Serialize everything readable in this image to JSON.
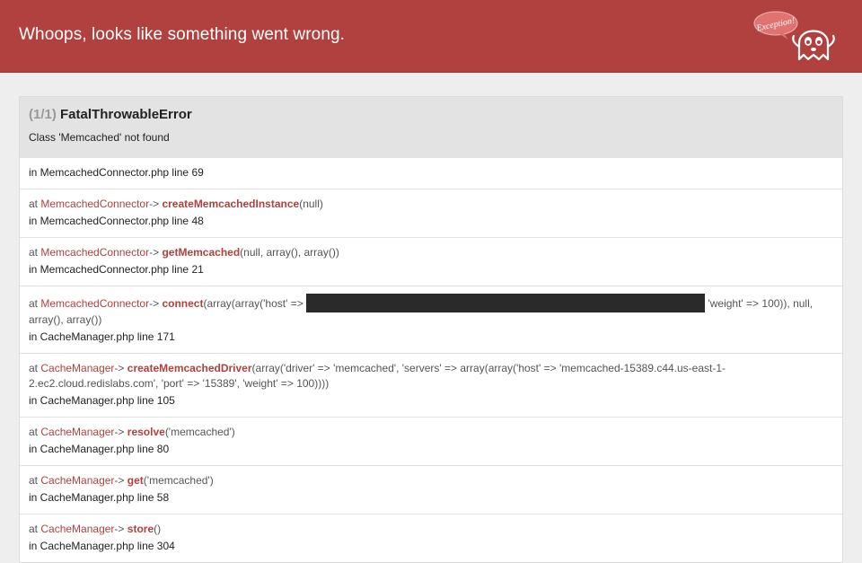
{
  "header": {
    "title": "Whoops, looks like something went wrong.",
    "logo_bubble": "Exception!",
    "bg_color": "#b0413e"
  },
  "exception": {
    "count": "(1/1)",
    "name": "FatalThrowableError",
    "message": "Class 'Memcached' not found",
    "first_location": "in MemcachedConnector.php line 69"
  },
  "frames": [
    {
      "at": "at",
      "class": "MemcachedConnector",
      "arrow": "->",
      "method": "createMemcachedInstance",
      "args": "(null)",
      "location": "in MemcachedConnector.php line 48"
    },
    {
      "at": "at",
      "class": "MemcachedConnector",
      "arrow": "->",
      "method": "getMemcached",
      "args": "(null, array(), array())",
      "location": "in MemcachedConnector.php line 21"
    },
    {
      "at": "at",
      "class": "MemcachedConnector",
      "arrow": "->",
      "method": "connect",
      "args_before": "(array(array('host' =>",
      "args_after": "'weight' => 100)), null, array(), array())",
      "location": "in CacheManager.php line 171"
    },
    {
      "at": "at",
      "class": "CacheManager",
      "arrow": "->",
      "method": "createMemcachedDriver",
      "args": "(array('driver' => 'memcached', 'servers' => array(array('host' => 'memcached-15389.c44.us-east-1-2.ec2.cloud.redislabs.com', 'port' => '15389', 'weight' => 100))))",
      "location": "in CacheManager.php line 105"
    },
    {
      "at": "at",
      "class": "CacheManager",
      "arrow": "->",
      "method": "resolve",
      "args": "('memcached')",
      "location": "in CacheManager.php line 80"
    },
    {
      "at": "at",
      "class": "CacheManager",
      "arrow": "->",
      "method": "get",
      "args": "('memcached')",
      "location": "in CacheManager.php line 58"
    },
    {
      "at": "at",
      "class": "CacheManager",
      "arrow": "->",
      "method": "store",
      "args": "()",
      "location": "in CacheManager.php line 304"
    }
  ]
}
